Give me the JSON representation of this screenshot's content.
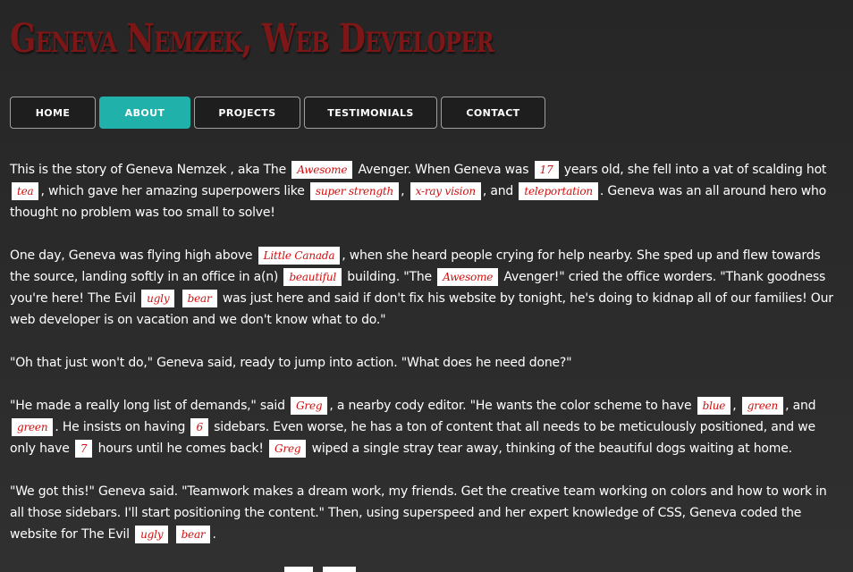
{
  "header": {
    "title": "Geneva Nemzek, Web Developer"
  },
  "nav": {
    "home": "HOME",
    "about": "ABOUT",
    "projects": "PROJECTS",
    "testimonials": "TESTIMONIALS",
    "contact": "CONTACT"
  },
  "colors": {
    "title": "#7d1717",
    "active_tab": "#20b2aa",
    "word_text": "#d01010",
    "word_bg": "#ffffff"
  },
  "story": {
    "p1": {
      "t1": "This is the story of Geneva Nemzek , aka The",
      "w1": "Awesome",
      "t2": "Avenger. When Geneva was",
      "w2": "17",
      "t3": "years old, she fell into a vat of scalding hot",
      "w3": "tea",
      "t4": ", which gave her amazing superpowers like",
      "w4": "super strength",
      "t5": ",",
      "w5": "x-ray vision",
      "t6": ", and",
      "w6": "teleportation",
      "t7": ". Geneva was an all around hero who thought no problem was too small to solve!"
    },
    "p2": {
      "t1": "One day, Geneva was flying high above",
      "w1": "Little Canada",
      "t2": ", when she heard people crying for help nearby. She sped up and flew towards the source, landing softly in an office in a(n)",
      "w2": "beautiful",
      "t3": "building. \"The",
      "w3": "Awesome",
      "t4": "Avenger!\" cried the office worders. \"Thank goodness you're here! The Evil",
      "w4": "ugly",
      "w5": "bear",
      "t5": "was just here and said if don't fix his website by tonight, he's doing to kidnap all of our families! Our web developer is on vacation and we don't know what to do.\""
    },
    "p3": {
      "t1": "\"Oh that just won't do,\" Geneva said, ready to jump into action. \"What does he need done?\""
    },
    "p4": {
      "t1": "\"He made a really long list of demands,\" said",
      "w1": "Greg",
      "t2": ", a nearby cody editor. \"He wants the color scheme to have",
      "w2": "blue",
      "t3": ",",
      "w3": "green",
      "t4": ", and",
      "w4": "green",
      "t5": ". He insists on having",
      "w5": "6",
      "t6": "sidebars. Even worse, he has a ton of content that all needs to be meticulously positioned, and we only have",
      "w6": "7",
      "t7": "hours until he comes back!",
      "w7": "Greg",
      "t8": "wiped a single stray tear away, thinking of the beautiful dogs waiting at home."
    },
    "p5": {
      "t1": "\"We got this!\" Geneva said. \"Teamwork makes a dream work, my friends. Get the creative team working on colors and how to work in all those sidebars. I'll start positioning the content.\" Then, using superspeed and her expert knowledge of CSS, Geneva coded the website for The Evil",
      "w1": "ugly",
      "w2": "bear",
      "t2": "."
    }
  }
}
